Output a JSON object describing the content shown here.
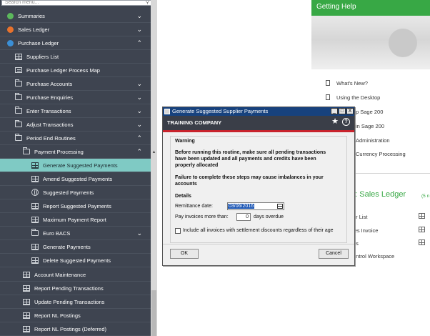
{
  "colors": {
    "sidebar_bg": "#3e4450",
    "active_item": "#7fcac4",
    "accent_green": "#38a845",
    "dialog_title": "#17427e",
    "dialog_header": "#3a3e48",
    "warning_red": "#c8232c"
  },
  "search": {
    "placeholder": "Search menu..."
  },
  "sidebar": {
    "items": [
      {
        "label": "Summaries",
        "icon": "pie-chart-icon"
      },
      {
        "label": "Sales Ledger",
        "icon": "person-icon"
      },
      {
        "label": "Purchase Ledger",
        "icon": "person-icon"
      },
      {
        "label": "Suppliers List",
        "icon": "grid-icon"
      },
      {
        "label": "Purchase Ledger Process Map",
        "icon": "map-icon"
      },
      {
        "label": "Purchase Accounts",
        "icon": "folder-icon"
      },
      {
        "label": "Purchase Enquiries",
        "icon": "folder-icon"
      },
      {
        "label": "Enter Transactions",
        "icon": "folder-icon"
      },
      {
        "label": "Adjust Transactions",
        "icon": "folder-icon"
      },
      {
        "label": "Period End Routines",
        "icon": "folder-icon"
      },
      {
        "label": "Payment Processing",
        "icon": "folder-icon"
      },
      {
        "label": "Generate Suggested Payments",
        "icon": "grid-icon"
      },
      {
        "label": "Amend Suggested Payments",
        "icon": "grid-icon"
      },
      {
        "label": "Suggested Payments",
        "icon": "globe-icon"
      },
      {
        "label": "Report Suggested Payments",
        "icon": "grid-icon"
      },
      {
        "label": "Maximum Payment Report",
        "icon": "grid-icon"
      },
      {
        "label": "Euro BACS",
        "icon": "folder-icon"
      },
      {
        "label": "Generate Payments",
        "icon": "grid-icon"
      },
      {
        "label": "Delete Suggested Payments",
        "icon": "grid-icon"
      },
      {
        "label": "Account Maintenance",
        "icon": "grid-icon"
      },
      {
        "label": "Report Pending Transactions",
        "icon": "grid-icon"
      },
      {
        "label": "Update Pending Transactions",
        "icon": "grid-icon"
      },
      {
        "label": "Report NL Postings",
        "icon": "grid-icon"
      },
      {
        "label": "Report NL Postings (Deferred)",
        "icon": "grid-icon"
      }
    ]
  },
  "help": {
    "title": "Getting Help",
    "links": [
      "What's New?",
      "Using the Desktop",
      "p Sage 200",
      "in Sage 200",
      "Administration",
      "Currency Processing"
    ]
  },
  "welcome": {
    "title": "to: Sales Ledger",
    "suffix": "(5 n",
    "tasks": [
      "er List",
      "les Invoice",
      "ns",
      "ontrol Workspace"
    ]
  },
  "dialog": {
    "title": "Generate Suggested Supplier Payments",
    "minimize": "_",
    "maximize": "□",
    "close": "X",
    "company": "TRAINING COMPANY",
    "warning_heading": "Warning",
    "warning_line1": "Before running this routine, make sure all pending transactions",
    "warning_line2": "have been updated and all payments and credits have been",
    "warning_line3": "properly allocated",
    "failure_line1": "Failure to complete these steps may cause imbalances in your",
    "failure_line2": "accounts",
    "details_heading": "Details",
    "remittance_label": "Remittance date:",
    "remittance_value": "03/06/2016",
    "overdue_label": "Pay invoices more than:",
    "overdue_value": "0",
    "overdue_suffix": "days overdue",
    "include_label": "Include all invoices with settlement discounts regardless of their age",
    "ok": "OK",
    "cancel": "Cancel"
  }
}
